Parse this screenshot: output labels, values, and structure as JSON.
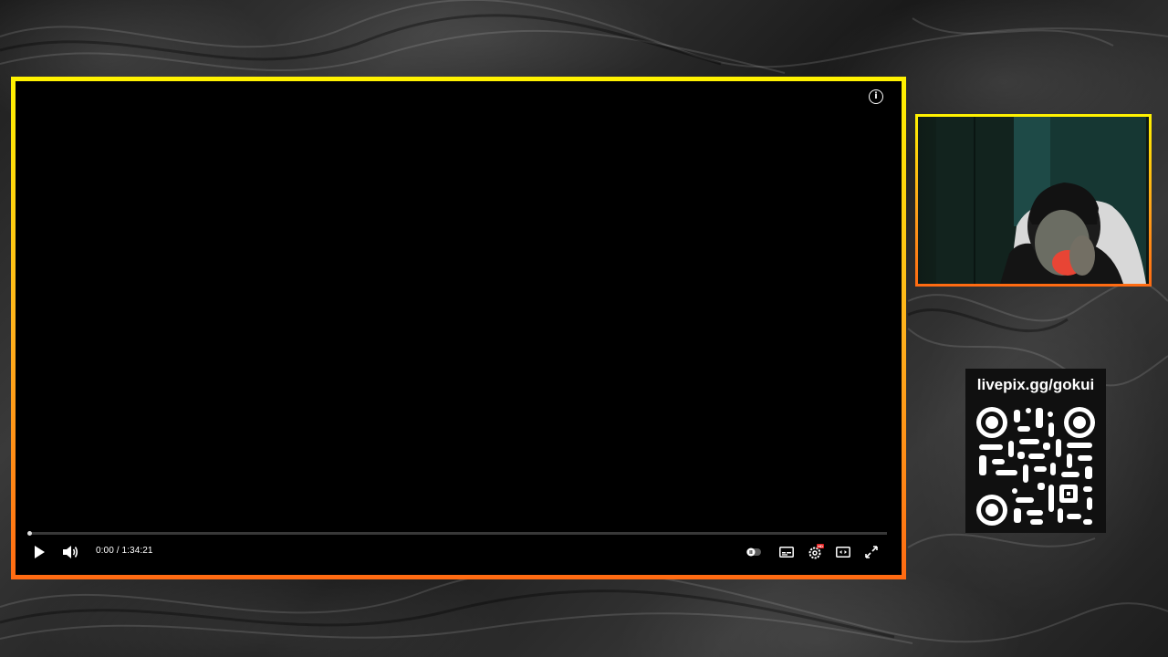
{
  "player": {
    "time_display": "0:00 / 1:34:21",
    "progress_fraction": 0.0,
    "icons": {
      "info": "info-icon",
      "play": "play-icon",
      "volume": "volume-icon",
      "autoplay": "autoplay-toggle-icon",
      "subtitles": "subtitles-icon",
      "settings": "settings-icon",
      "theater": "theater-mode-icon",
      "fullscreen": "fullscreen-icon"
    },
    "settings_badge": "HD",
    "info_glyph": "i"
  },
  "frame_colors": {
    "top": "#fff200",
    "bottom": "#ff6a12"
  },
  "donation": {
    "url_label": "livepix.gg/gokui"
  }
}
